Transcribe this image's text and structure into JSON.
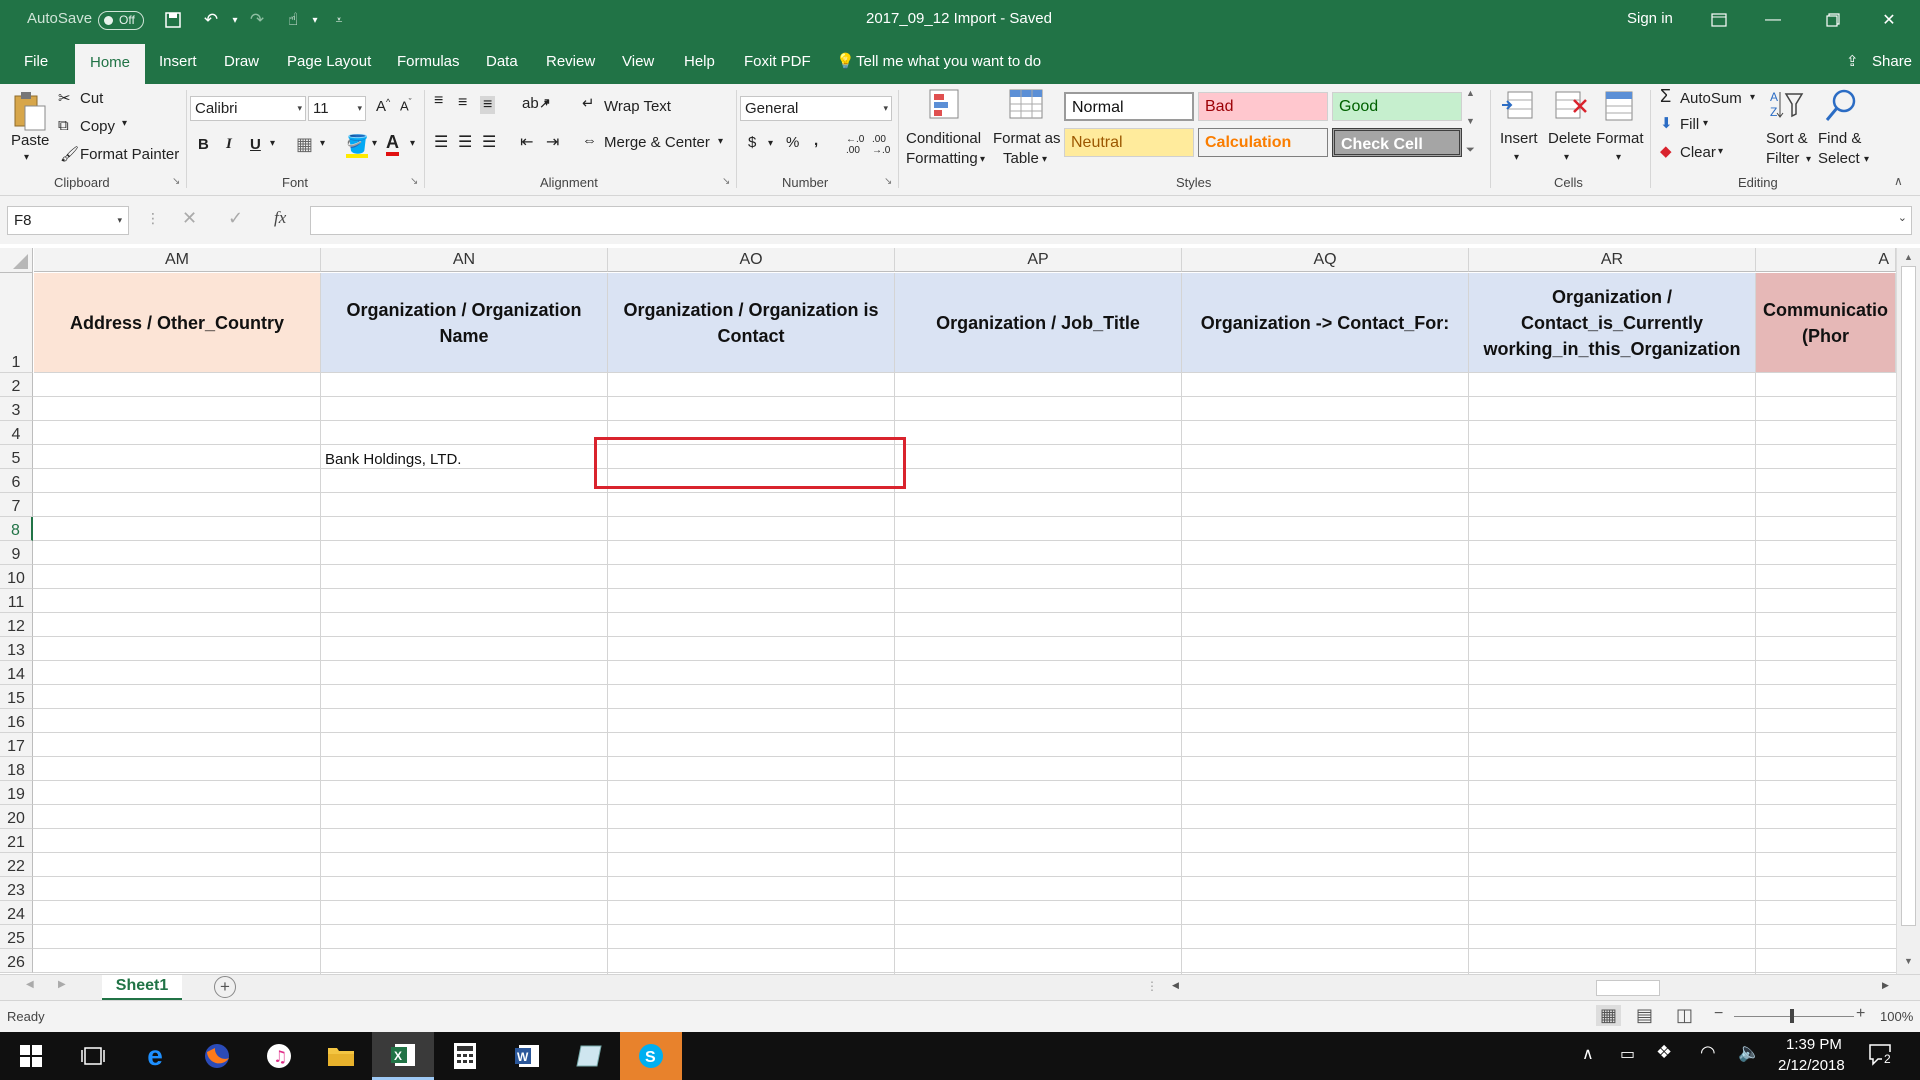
{
  "titlebar": {
    "autosave_label": "AutoSave",
    "autosave_state": "Off",
    "document_title": "2017_09_12 Import  -  Saved",
    "sign_in": "Sign in"
  },
  "tabs": [
    "File",
    "Home",
    "Insert",
    "Draw",
    "Page Layout",
    "Formulas",
    "Data",
    "Review",
    "View",
    "Help",
    "Foxit PDF"
  ],
  "tell_me": "Tell me what you want to do",
  "share": "Share",
  "ribbon": {
    "clipboard": {
      "paste": "Paste",
      "cut": "Cut",
      "copy": "Copy",
      "format_painter": "Format Painter",
      "label": "Clipboard"
    },
    "font": {
      "name": "Calibri",
      "size": "11",
      "label": "Font"
    },
    "alignment": {
      "wrap_text": "Wrap Text",
      "merge_center": "Merge & Center",
      "label": "Alignment"
    },
    "number": {
      "format": "General",
      "label": "Number"
    },
    "styles": {
      "conditional_1": "Conditional",
      "conditional_2": "Formatting",
      "format_table_1": "Format as",
      "format_table_2": "Table",
      "normal": "Normal",
      "bad": "Bad",
      "good": "Good",
      "neutral": "Neutral",
      "calculation": "Calculation",
      "check_cell": "Check Cell",
      "label": "Styles"
    },
    "cells": {
      "insert": "Insert",
      "delete": "Delete",
      "format": "Format",
      "label": "Cells"
    },
    "editing": {
      "autosum": "AutoSum",
      "fill": "Fill",
      "clear": "Clear",
      "sort_1": "Sort &",
      "sort_2": "Filter",
      "find_1": "Find &",
      "find_2": "Select",
      "label": "Editing"
    }
  },
  "formula_bar": {
    "name_box": "F8",
    "fx": "fx"
  },
  "grid": {
    "columns": [
      "AM",
      "AN",
      "AO",
      "AP",
      "AQ",
      "AR",
      "A"
    ],
    "headers": {
      "am": "Address / Other_Country",
      "an": "Organization / Organization Name",
      "ao": "Organization / Organization is Contact",
      "ap": "Organization / Job_Title",
      "aq": "Organization -> Contact_For:",
      "ar": "Organization / Contact_is_Currently working_in_this_Organization",
      "as": "Communicatio (Phor"
    },
    "rows": [
      "1",
      "2",
      "3",
      "4",
      "5",
      "6",
      "7",
      "8",
      "9",
      "10",
      "11",
      "12",
      "13",
      "14",
      "15",
      "16",
      "17",
      "18",
      "19",
      "20",
      "21",
      "22",
      "23",
      "24",
      "25",
      "26"
    ],
    "cell_an5": "Bank Holdings, LTD."
  },
  "sheet": {
    "name": "Sheet1"
  },
  "status": {
    "ready": "Ready",
    "zoom": "100%"
  },
  "taskbar": {
    "time": "1:39 PM",
    "date": "2/12/2018",
    "notifications": "2"
  },
  "colors": {
    "excel_green": "#217346",
    "highlight_red": "#d9232d"
  }
}
